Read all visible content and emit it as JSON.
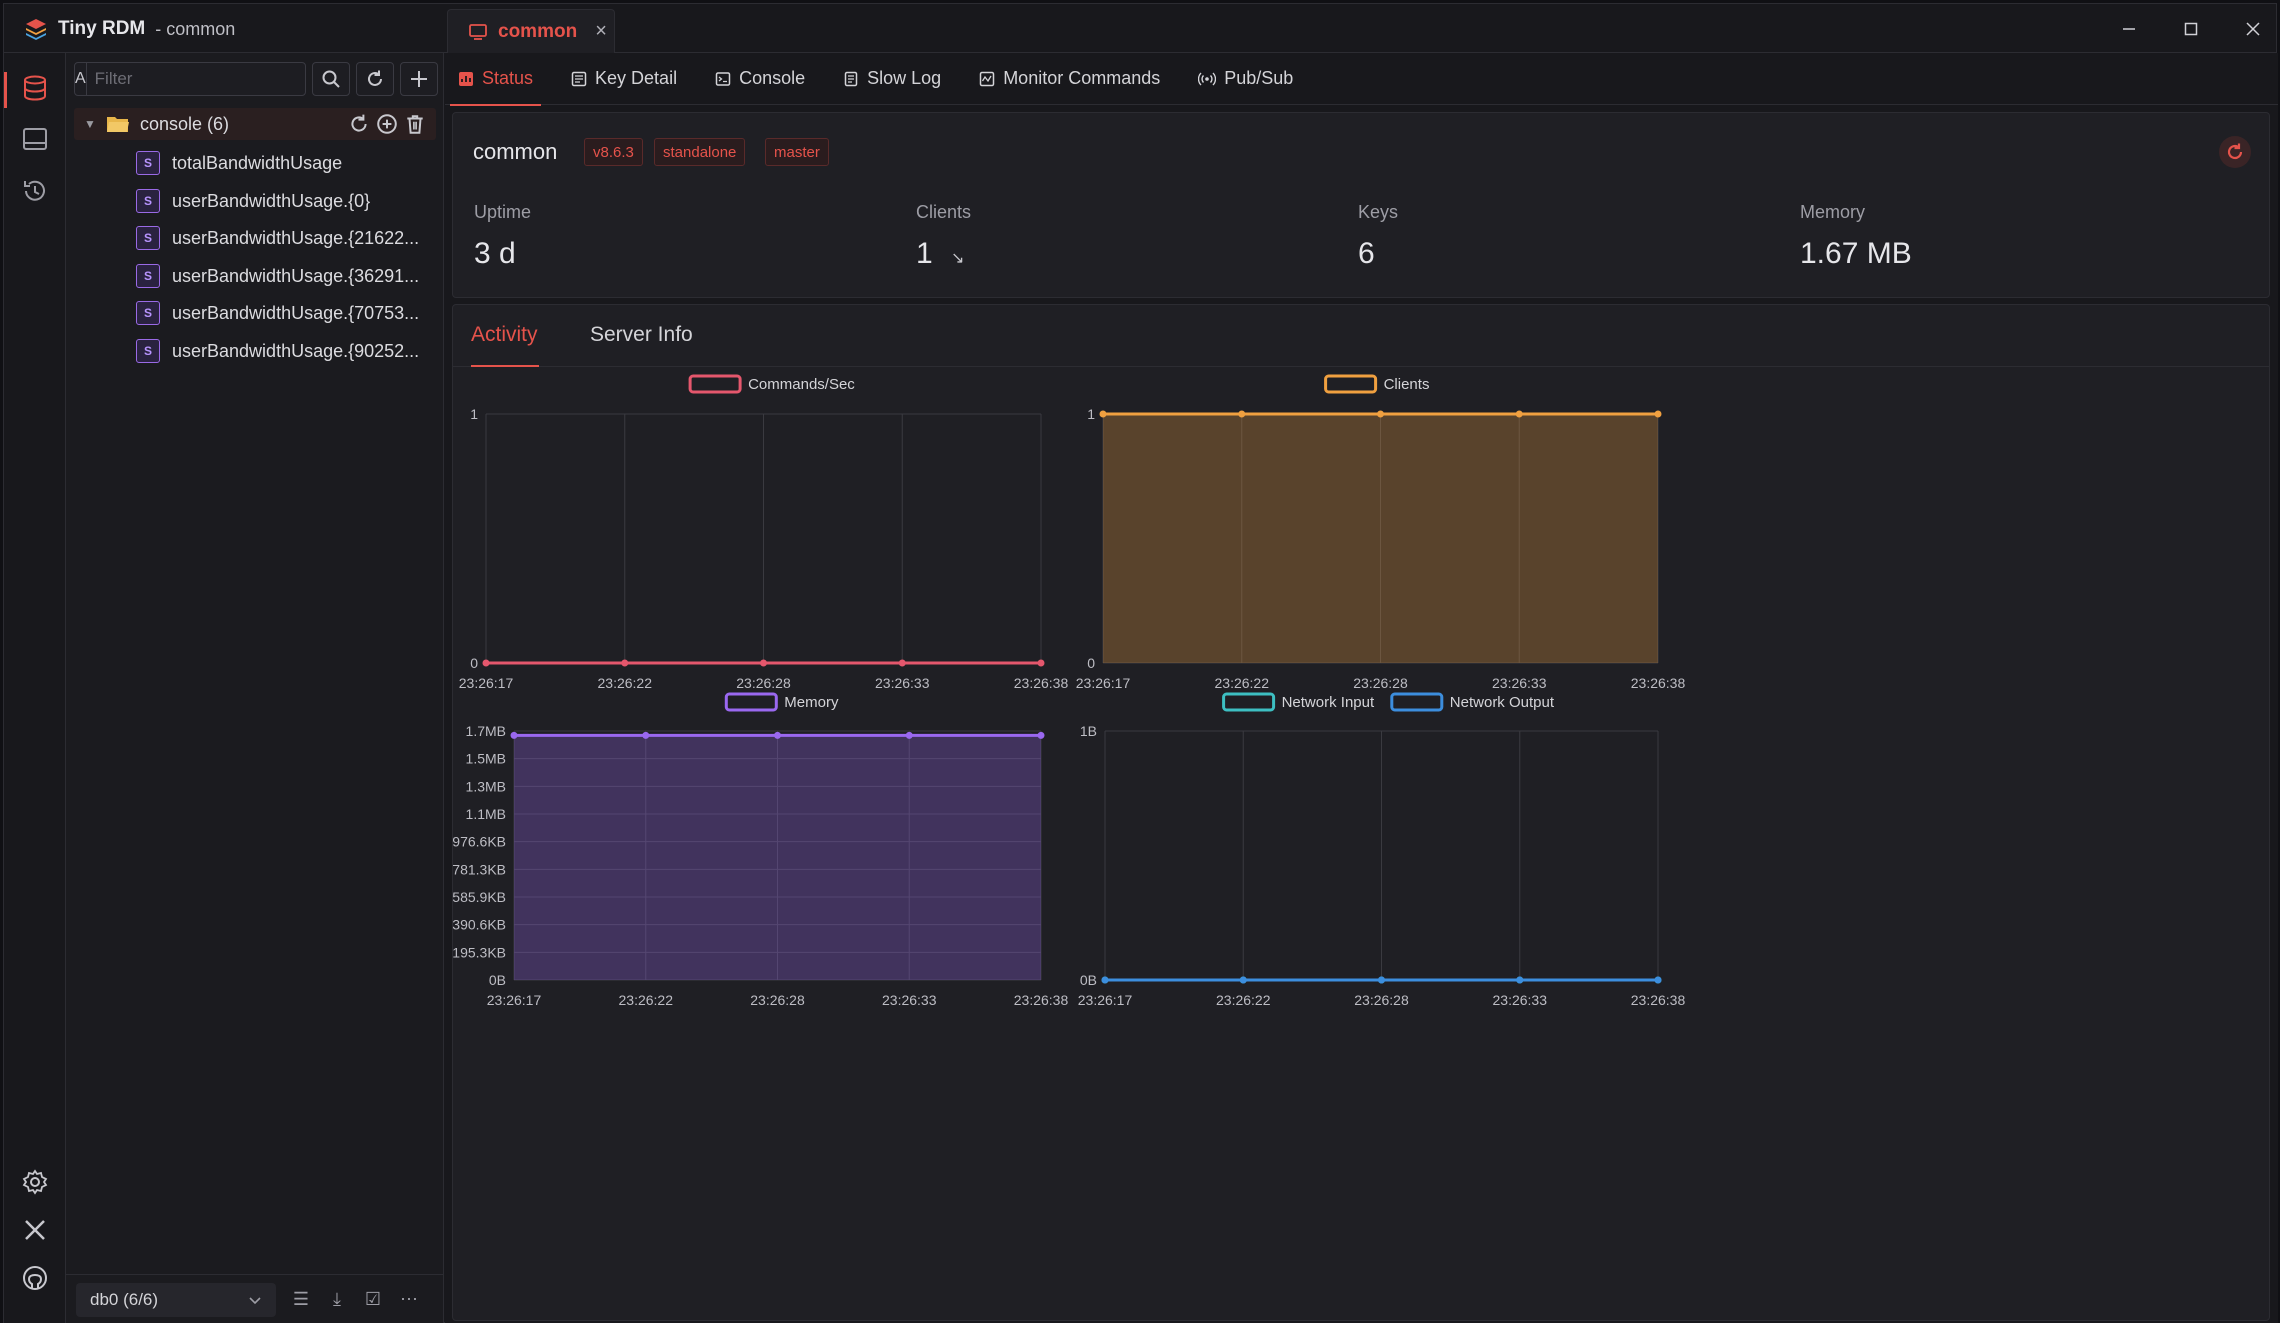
{
  "app": {
    "name": "Tiny RDM",
    "subtitle": "- common"
  },
  "tab": {
    "label": "common"
  },
  "sidebar": {
    "filter_prefix": "A",
    "filter_placeholder": "Filter",
    "root": {
      "label": "console (6)"
    },
    "keys": [
      {
        "type": "S",
        "label": "totalBandwidthUsage"
      },
      {
        "type": "S",
        "label": "userBandwidthUsage.{0}"
      },
      {
        "type": "S",
        "label": "userBandwidthUsage.{21622..."
      },
      {
        "type": "S",
        "label": "userBandwidthUsage.{36291..."
      },
      {
        "type": "S",
        "label": "userBandwidthUsage.{70753..."
      },
      {
        "type": "S",
        "label": "userBandwidthUsage.{90252..."
      }
    ],
    "db_select": "db0 (6/6)"
  },
  "subtabs": [
    "Status",
    "Key Detail",
    "Console",
    "Slow Log",
    "Monitor Commands",
    "Pub/Sub"
  ],
  "server": {
    "name": "common",
    "tags": [
      "v8.6.3",
      "standalone",
      "master"
    ],
    "stats": [
      {
        "label": "Uptime",
        "value": "3 d"
      },
      {
        "label": "Clients",
        "value": "1",
        "trend": "↘"
      },
      {
        "label": "Keys",
        "value": "6"
      },
      {
        "label": "Memory",
        "value": "1.67 MB"
      }
    ]
  },
  "inner_tabs": [
    "Activity",
    "Server Info"
  ],
  "colors": {
    "accent": "#e5534b",
    "commands": "#e5576d",
    "clients": "#f0a040",
    "memory": "#9a68f0",
    "net_in": "#3dbfc2",
    "net_out": "#3c8ede"
  },
  "chart_data": [
    {
      "type": "line",
      "x": [
        "23:26:17",
        "23:26:22",
        "23:26:28",
        "23:26:33",
        "23:26:38"
      ],
      "series": [
        {
          "name": "Commands/Sec",
          "values": [
            0,
            0,
            0,
            0,
            0
          ]
        }
      ],
      "y_ticks": [
        "0",
        "1"
      ],
      "ylim": [
        0,
        1
      ]
    },
    {
      "type": "area",
      "x": [
        "23:26:17",
        "23:26:22",
        "23:26:28",
        "23:26:33",
        "23:26:38"
      ],
      "series": [
        {
          "name": "Clients",
          "values": [
            1,
            1,
            1,
            1,
            1
          ]
        }
      ],
      "y_ticks": [
        "0",
        "1"
      ],
      "ylim": [
        0,
        1
      ]
    },
    {
      "type": "area",
      "x": [
        "23:26:17",
        "23:26:22",
        "23:26:28",
        "23:26:33",
        "23:26:38"
      ],
      "series": [
        {
          "name": "Memory",
          "values": [
            1.67,
            1.67,
            1.67,
            1.67,
            1.67
          ]
        }
      ],
      "y_ticks": [
        "0B",
        "195.3KB",
        "390.6KB",
        "585.9KB",
        "781.3KB",
        "976.6KB",
        "1.1MB",
        "1.3MB",
        "1.5MB",
        "1.7MB"
      ],
      "ylim": [
        0,
        1.7
      ]
    },
    {
      "type": "line",
      "x": [
        "23:26:17",
        "23:26:22",
        "23:26:28",
        "23:26:33",
        "23:26:38"
      ],
      "series": [
        {
          "name": "Network Input",
          "values": [
            0,
            0,
            0,
            0,
            0
          ]
        },
        {
          "name": "Network Output",
          "values": [
            0,
            0,
            0,
            0,
            0
          ]
        }
      ],
      "y_ticks": [
        "0B",
        "1B"
      ],
      "ylim": [
        0,
        1
      ]
    }
  ]
}
